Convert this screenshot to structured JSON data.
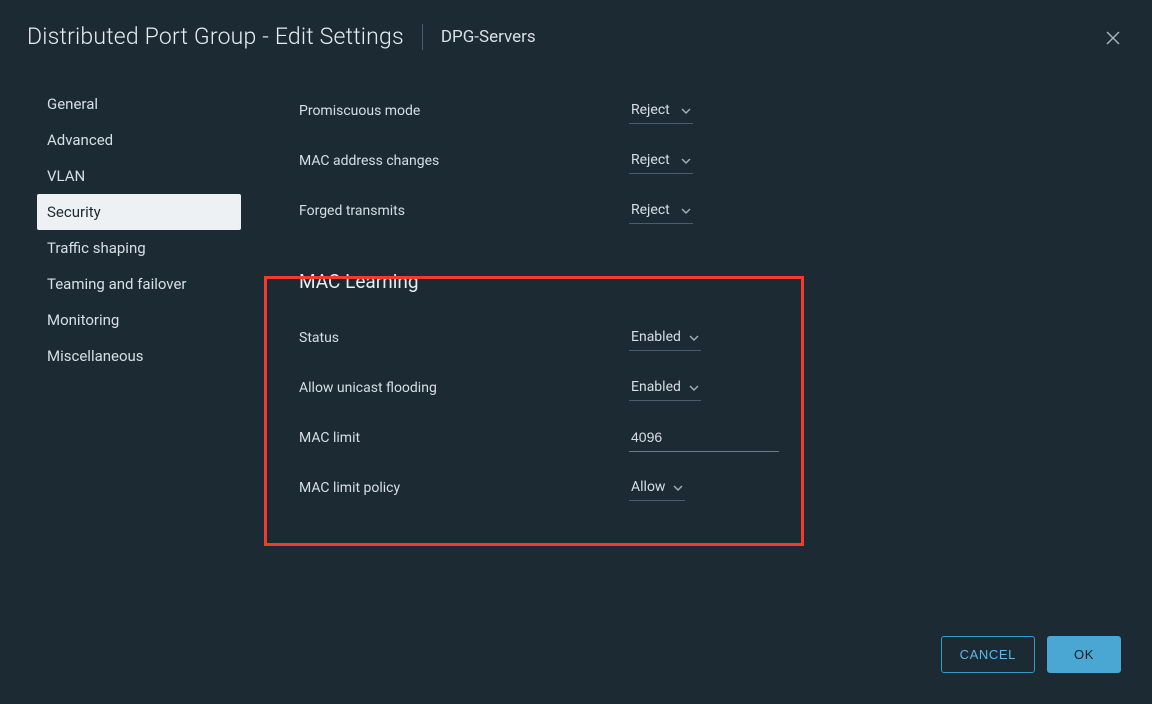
{
  "header": {
    "title": "Distributed Port Group - Edit Settings",
    "subtitle": "DPG-Servers"
  },
  "sidebar": {
    "items": [
      {
        "label": "General",
        "active": false
      },
      {
        "label": "Advanced",
        "active": false
      },
      {
        "label": "VLAN",
        "active": false
      },
      {
        "label": "Security",
        "active": true
      },
      {
        "label": "Traffic shaping",
        "active": false
      },
      {
        "label": "Teaming and failover",
        "active": false
      },
      {
        "label": "Monitoring",
        "active": false
      },
      {
        "label": "Miscellaneous",
        "active": false
      }
    ]
  },
  "form": {
    "promiscuous": {
      "label": "Promiscuous mode",
      "value": "Reject"
    },
    "mac_changes": {
      "label": "MAC address changes",
      "value": "Reject"
    },
    "forged": {
      "label": "Forged transmits",
      "value": "Reject"
    },
    "mac_learning": {
      "title": "MAC Learning",
      "status": {
        "label": "Status",
        "value": "Enabled"
      },
      "unicast": {
        "label": "Allow unicast flooding",
        "value": "Enabled"
      },
      "limit": {
        "label": "MAC limit",
        "value": "4096"
      },
      "policy": {
        "label": "MAC limit policy",
        "value": "Allow"
      }
    }
  },
  "footer": {
    "cancel": "CANCEL",
    "ok": "OK"
  }
}
